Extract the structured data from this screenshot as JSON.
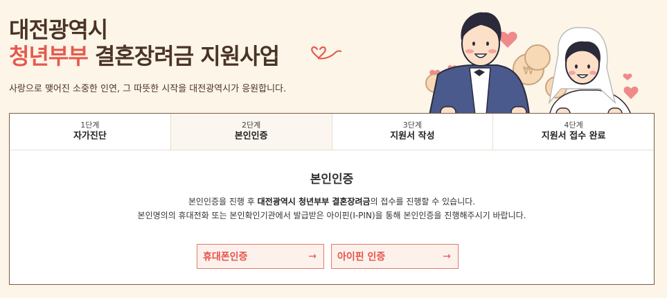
{
  "header": {
    "title_line1": "대전광역시",
    "title_accent": "청년부부",
    "title_rest": " 결혼장려금 지원사업",
    "subtitle": "사랑으로 맺어진 소중한 인연, 그 따뜻한 시작을 대전광역시가 응원합니다."
  },
  "steps": [
    {
      "num": "1단계",
      "label": "자가진단"
    },
    {
      "num": "2단계",
      "label": "본인인증"
    },
    {
      "num": "3단계",
      "label": "지원서 작성"
    },
    {
      "num": "4단계",
      "label": "지원서 접수 완료"
    }
  ],
  "content": {
    "title": "본인인증",
    "desc1_pre": "본인인증을 진행 후 ",
    "desc1_bold": "대전광역시 청년부부 결혼장려금",
    "desc1_post": "의 접수를 진행할 수 있습니다.",
    "desc2": "본인명의의 휴대전화 또는 본인확인기관에서 발급받은 아이핀(I-PIN)을 통해 본인인증을 진행해주시기 바랍니다."
  },
  "buttons": {
    "phone_label": "휴대폰인증",
    "ipin_label": "아이핀 인증",
    "arrow": "→"
  },
  "colors": {
    "accent": "#e55a4e",
    "brown": "#4a3426",
    "background": "#fcf5e8"
  }
}
